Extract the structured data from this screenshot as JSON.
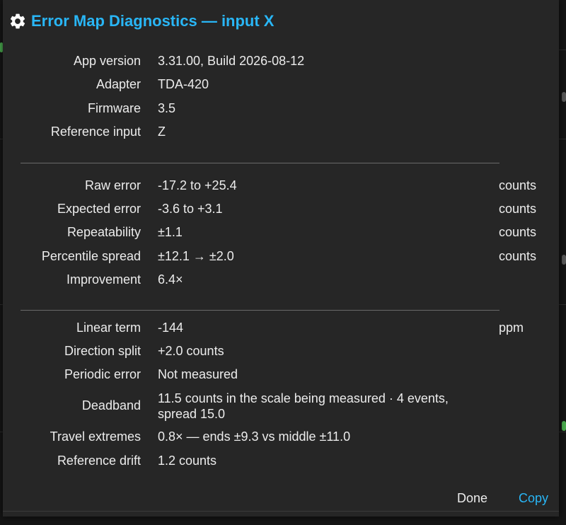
{
  "dialog": {
    "title": "Error Map Diagnostics — input X",
    "icon": "gear-icon",
    "accent_color": "#29b6f6"
  },
  "info": [
    {
      "label": "App version",
      "value": "3.31.00, Build 2026-08-12"
    },
    {
      "label": "Adapter",
      "value": "TDA-420"
    },
    {
      "label": "Firmware",
      "value": "3.5"
    },
    {
      "label": "Reference input",
      "value": "Z"
    }
  ],
  "stats": [
    {
      "label": "Raw error",
      "value": "-17.2 to +25.4",
      "unit": "counts"
    },
    {
      "label": "Expected error",
      "value": "-3.6 to +3.1",
      "unit": "counts"
    },
    {
      "label": "Repeatability",
      "value": "±1.1",
      "unit": "counts"
    },
    {
      "label": "Percentile spread",
      "value": "±12.1 → ±2.0",
      "unit": "counts"
    },
    {
      "label": "Improvement",
      "value": "6.4×",
      "unit": ""
    }
  ],
  "details": [
    {
      "label": "Linear term",
      "value": "-144",
      "unit": "ppm"
    },
    {
      "label": "Direction split",
      "value": "+2.0 counts",
      "unit": ""
    },
    {
      "label": "Periodic error",
      "value": "Not measured",
      "unit": ""
    },
    {
      "label": "Deadband",
      "value": "11.5 counts in the scale being measured · 4 events, spread 15.0",
      "unit": ""
    },
    {
      "label": "Travel extremes",
      "value": "0.8× — ends ±9.3 vs middle ±11.0",
      "unit": ""
    },
    {
      "label": "Reference drift",
      "value": "1.2 counts",
      "unit": ""
    }
  ],
  "buttons": {
    "done": "Done",
    "copy": "Copy"
  }
}
